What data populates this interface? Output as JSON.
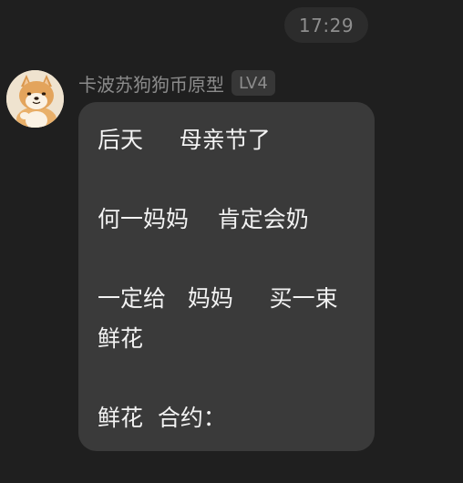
{
  "timestamp": "17:29",
  "sender": {
    "name": "卡波苏狗狗币原型",
    "level": "LV4"
  },
  "message": {
    "lines": [
      "后天     母亲节了",
      "",
      "何一妈妈    肯定会奶",
      "",
      "一定给   妈妈     买一束",
      "鲜花",
      "",
      "鲜花  合约："
    ]
  },
  "colors": {
    "background": "#1f1f1f",
    "bubble": "#3a3a3a",
    "pill": "#2c2c2c",
    "message_text": "#f2f2f2",
    "muted_text": "#8b8b8b"
  },
  "icons": {
    "avatar": "shiba-inu-avatar"
  }
}
